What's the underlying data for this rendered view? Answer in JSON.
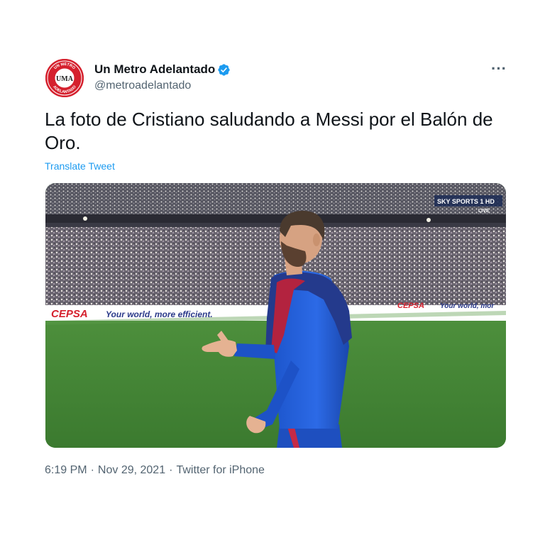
{
  "account": {
    "display_name": "Un Metro Adelantado",
    "handle": "@metroadelantado",
    "verified": true,
    "avatar_icon": "uma-logo-icon",
    "avatar_text": "UMA",
    "avatar_ring_text": "UN METRO ADELANTADO",
    "avatar_color": "#d5212e"
  },
  "tweet": {
    "text": "La foto de Cristiano saludando a Messi por el Balón de Oro.",
    "translate_label": "Translate Tweet",
    "media": {
      "broadcaster_label": "SKY SPORTS 1 HD",
      "live_label": "LIVE",
      "board_text_left": "CEPSA",
      "board_slogan_left": "Your world, more efficient.",
      "board_text_right": "CEPSA",
      "board_slogan_right": "Your world, mor"
    },
    "time": "6:19 PM",
    "separator": "·",
    "date": "Nov 29, 2021",
    "source": "Twitter for iPhone"
  },
  "colors": {
    "accent": "#1d9bf0",
    "text_primary": "#0f1419",
    "text_secondary": "#536471"
  },
  "icons": {
    "verified": "verified-badge-icon",
    "more": "more-options-icon"
  }
}
